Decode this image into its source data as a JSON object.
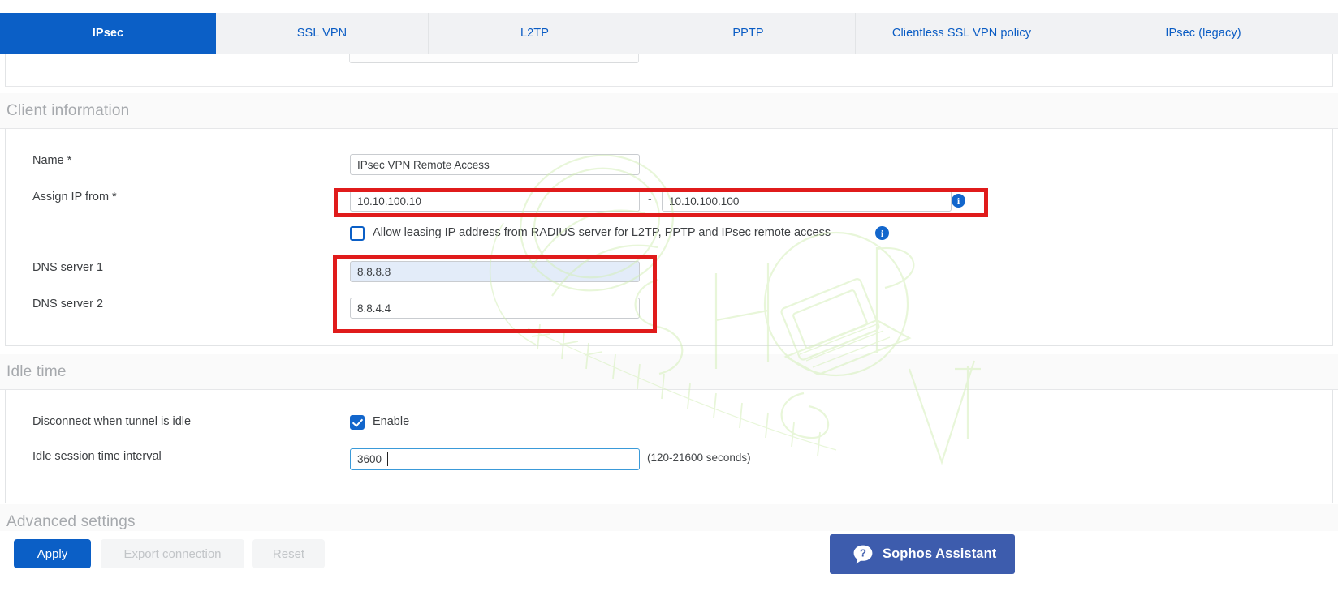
{
  "tabs": [
    {
      "label": "IPsec",
      "active": true
    },
    {
      "label": "SSL VPN",
      "active": false
    },
    {
      "label": "L2TP",
      "active": false
    },
    {
      "label": "PPTP",
      "active": false
    },
    {
      "label": "Clientless SSL VPN policy",
      "active": false
    },
    {
      "label": "IPsec (legacy)",
      "active": false
    }
  ],
  "sections": {
    "client_information": {
      "title": "Client information",
      "name": {
        "label": "Name *",
        "value": "IPsec VPN Remote Access"
      },
      "assign_ip_from": {
        "label": "Assign IP from *",
        "start_value": "10.10.100.10",
        "separator": "-",
        "end_value": "10.10.100.100",
        "info_icon": "info-icon"
      },
      "radius_lease": {
        "label": "Allow leasing IP address from RADIUS server for L2TP, PPTP and IPsec remote access",
        "checked": false,
        "info_icon": "info-icon"
      },
      "dns_server_1": {
        "label": "DNS server 1",
        "value": "8.8.8.8"
      },
      "dns_server_2": {
        "label": "DNS server 2",
        "value": "8.8.4.4"
      }
    },
    "idle_time": {
      "title": "Idle time",
      "disconnect_when_idle": {
        "label": "Disconnect when tunnel is idle",
        "checkbox_label": "Enable",
        "checked": true
      },
      "idle_session_interval": {
        "label": "Idle session time interval",
        "value": "3600",
        "hint": "(120-21600 seconds)"
      }
    },
    "advanced_settings": {
      "title": "Advanced settings"
    }
  },
  "footer": {
    "apply_label": "Apply",
    "export_label": "Export connection",
    "reset_label": "Reset",
    "assistant_label": "Sophos Assistant",
    "assistant_icon": "question-speech-bubble-icon"
  },
  "watermark": {
    "brand": "ITSHOP.VN",
    "tagline": "CHUYÊN NGHIỆP - THÂN THIỆN",
    "color": "#d8f0c0"
  },
  "annotations": {
    "highlight_color": "#e01b1b",
    "boxes": [
      {
        "name": "assign-ip-range-highlight"
      },
      {
        "name": "dns-servers-highlight"
      }
    ]
  }
}
